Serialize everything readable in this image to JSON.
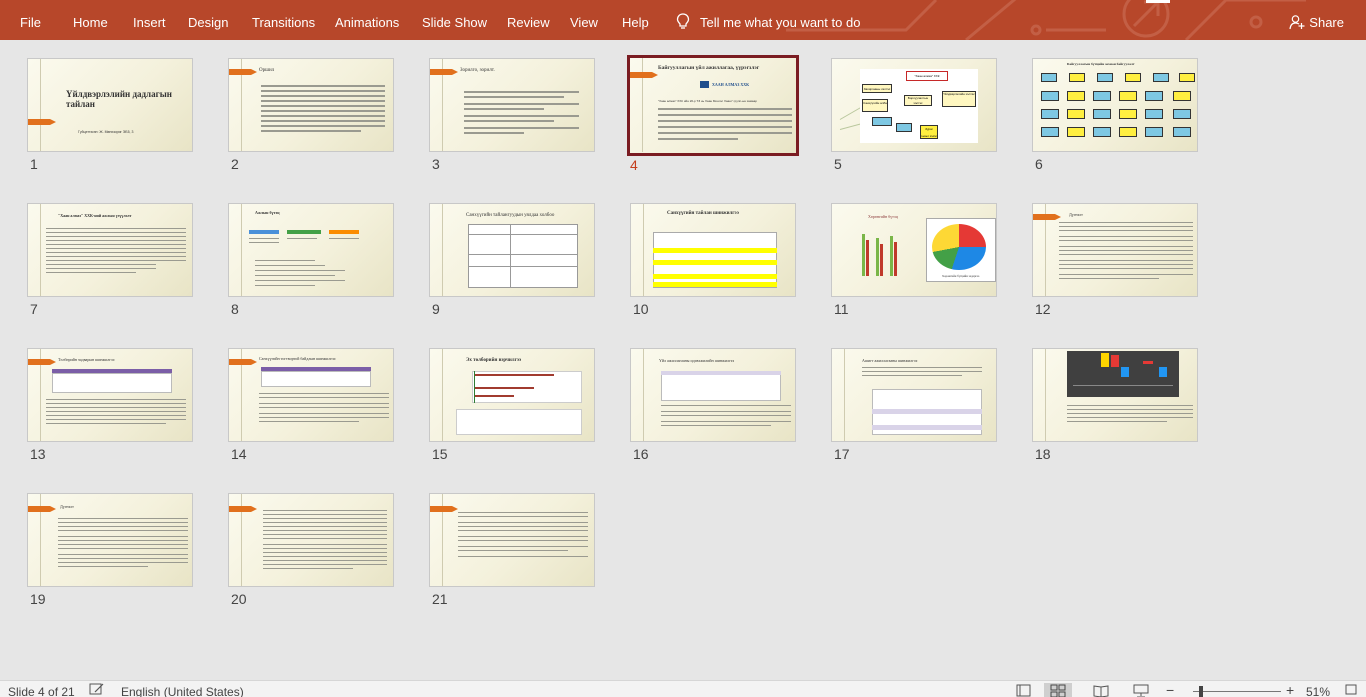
{
  "ribbon": {
    "tabs": [
      "File",
      "Home",
      "Insert",
      "Design",
      "Transitions",
      "Animations",
      "Slide Show",
      "Review",
      "View",
      "Help"
    ],
    "tell_me": "Tell me what you want to do",
    "share": "Share"
  },
  "slides": {
    "s1": {
      "number": "1",
      "title": "Үйлдвэрлэлийн дадлагын тайлан",
      "subtitle": "Гүйцэтгэсэн:   Ж. Мөнхзориг  ЭБ5, 3"
    },
    "s2": {
      "number": "2",
      "title": "Оршил"
    },
    "s3": {
      "number": "3",
      "title": "Зорилго, зорилт."
    },
    "s4": {
      "number": "4",
      "title": "Байгууллагын үйл ажиллагаа, үүрэгзлэг",
      "logo": "ХААН АЛМАЗ ХХК",
      "body": "\"Хаан алмаз\" ХХК ийн 20-р ТЗ нь Хаан Монгол Хааш\" групп-ын хамаар"
    },
    "s5": {
      "number": "5",
      "labels": [
        "\"Хаан алмаз\" ХХК",
        "Захиргааны хэлтэс",
        "Борлуулалтын хэлтэс",
        "Үйлдвэрлэлийн хэлтэс",
        "Санхүүгийн алба",
        "Зураг төсөл хэсэг"
      ]
    },
    "s6": {
      "number": "6",
      "title": "Байгууллагын бүтцийн зохион байгуулалт"
    },
    "s7": {
      "number": "7",
      "title": "\"Хаан алмаз\" ХХК-ний ажлын үзүүлэлт"
    },
    "s8": {
      "number": "8",
      "title": "Ажлын бүтэц"
    },
    "s9": {
      "number": "9",
      "title": "Санхүүгийн тайлангуудын уялдаа холбоо"
    },
    "s10": {
      "number": "10",
      "title": "Санхүүгийн тайлан шинжилгээ"
    },
    "s11": {
      "number": "11",
      "title": "Хөрөнгийн бүтэц",
      "caption": "Хөрөнгийн бүтцийн задаргаа"
    },
    "s12": {
      "number": "12",
      "title": "Дүгнэлт"
    },
    "s13": {
      "number": "13",
      "title": "Төлбөрийн чадварын шинжилгээ"
    },
    "s14": {
      "number": "14",
      "title": "Санхүүгийн тогтвортой байдлын шинжилгээ"
    },
    "s15": {
      "number": "15",
      "title": "Эх төлбөрийн вэрчилгээ"
    },
    "s16": {
      "number": "16",
      "title": "Үйл ажиллагааны идэвхжилийн шинжилгээ"
    },
    "s17": {
      "number": "17",
      "title": "Ашигт ажиллагааны шинжилгээ"
    },
    "s18": {
      "number": "18"
    },
    "s19": {
      "number": "19",
      "title": "Дүгнэлт"
    },
    "s20": {
      "number": "20"
    },
    "s21": {
      "number": "21"
    }
  },
  "status": {
    "slide_info": "Slide 4 of 21",
    "language": "English (United States)",
    "zoom_minus": "−",
    "zoom_plus": "+",
    "zoom": "51%"
  },
  "colors": {
    "ribbon": "#b7472a",
    "accent": "#e1701d",
    "selected_border": "#7a1c22"
  }
}
